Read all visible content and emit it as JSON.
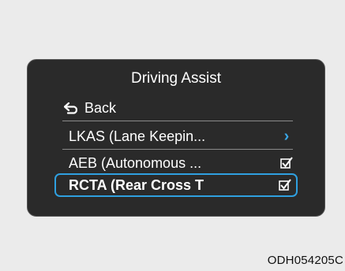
{
  "screen": {
    "title": "Driving Assist",
    "back_label": "Back",
    "items": [
      {
        "label": "LKAS (Lane Keepin...",
        "control": "chevron"
      },
      {
        "label": "AEB (Autonomous ...",
        "control": "checkbox",
        "checked": true
      },
      {
        "label": "RCTA (Rear Cross T",
        "control": "checkbox",
        "checked": true,
        "selected": true
      }
    ]
  },
  "figure_code": "ODH054205C",
  "colors": {
    "accent": "#2fa0e0",
    "screen_bg": "#2a2a2a",
    "page_bg": "#ebebeb"
  }
}
